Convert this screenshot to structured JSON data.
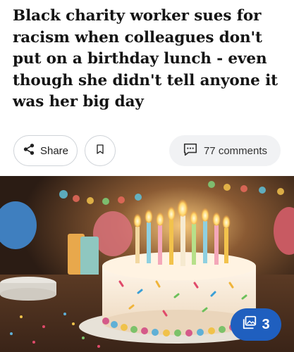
{
  "article": {
    "headline": "Black charity worker sues for racism when colleagues don't put on a birthday lunch - even though she didn't tell anyone it was her big day"
  },
  "actions": {
    "share_label": "Share",
    "share_icon": "share-icon",
    "bookmark_icon": "bookmark-icon",
    "comments_label": "77 comments",
    "comments_icon": "comment-icon"
  },
  "hero": {
    "alt_description": "birthday cake with lit candles",
    "gallery_count": "3",
    "gallery_icon": "image-gallery-icon",
    "badge_color": "#1f5fbf"
  }
}
